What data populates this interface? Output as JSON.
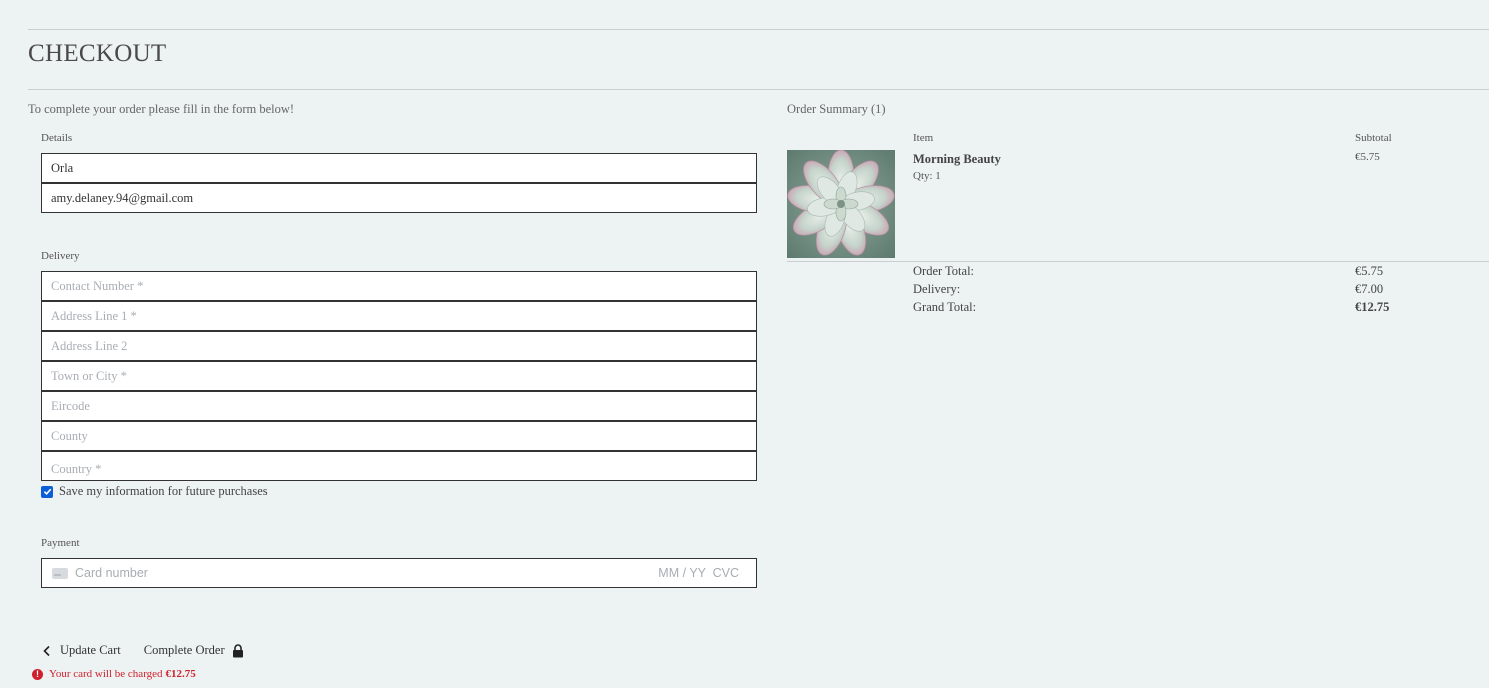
{
  "page": {
    "title": "CHECKOUT",
    "intro": "To complete your order please fill in the form below!"
  },
  "form": {
    "details": {
      "label": "Details",
      "full_name_value": "Orla",
      "email_value": "amy.delaney.94@gmail.com"
    },
    "delivery": {
      "label": "Delivery",
      "contact_placeholder": "Contact Number *",
      "address1_placeholder": "Address Line 1 *",
      "address2_placeholder": "Address Line 2",
      "town_placeholder": "Town or City *",
      "eircode_placeholder": "Eircode",
      "county_placeholder": "County",
      "country_placeholder": "Country *"
    },
    "save_info": {
      "label": "Save my information for future purchases",
      "checked": true
    },
    "payment": {
      "label": "Payment",
      "card_placeholder": "Card number",
      "expiry_placeholder": "MM / YY",
      "cvc_placeholder": "CVC"
    }
  },
  "actions": {
    "update_cart": "Update Cart",
    "complete_order": "Complete Order",
    "charge_text": "Your card will be charged",
    "charge_amount": "€12.75"
  },
  "summary": {
    "title": "Order Summary (1)",
    "item_header": "Item",
    "subtotal_header": "Subtotal",
    "item": {
      "name": "Morning Beauty",
      "qty": "Qty: 1",
      "price": "€5.75"
    },
    "order_total_label": "Order Total:",
    "order_total": "€5.75",
    "delivery_label": "Delivery:",
    "delivery": "€7.00",
    "grand_total_label": "Grand Total:",
    "grand_total": "€12.75"
  },
  "colors": {
    "background": "#edf2f2",
    "error": "#d0202e",
    "checkbox": "#0b5ed7"
  }
}
